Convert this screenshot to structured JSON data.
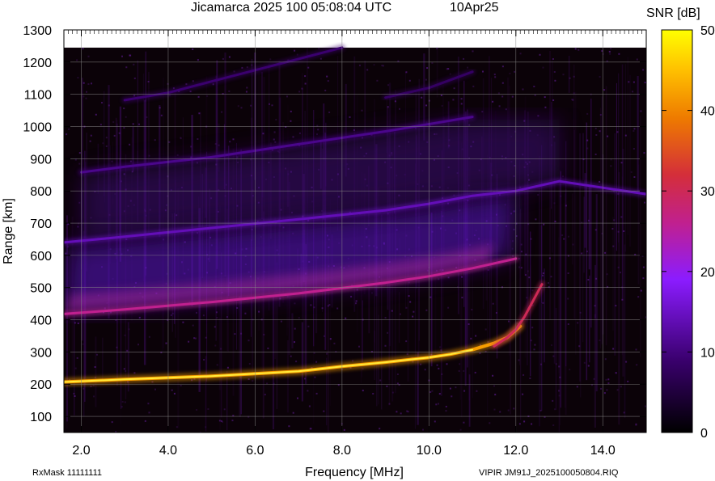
{
  "chart_data": {
    "type": "heatmap",
    "title": "Jicamarca 2025 100 05:08:04 UTC",
    "date_label": "10Apr25",
    "xlabel": "Frequency [MHz]",
    "ylabel": "Range [km]",
    "colorbar_label": "SNR [dB]",
    "xlim": [
      1.6,
      15.0
    ],
    "ylim": [
      50,
      1300
    ],
    "x_ticks": [
      "2.0",
      "4.0",
      "6.0",
      "8.0",
      "10.0",
      "12.0",
      "14.0"
    ],
    "x_tick_values": [
      2,
      4,
      6,
      8,
      10,
      12,
      14
    ],
    "y_ticks": [
      "100",
      "200",
      "300",
      "400",
      "500",
      "600",
      "700",
      "800",
      "900",
      "1000",
      "1100",
      "1200",
      "1300"
    ],
    "y_tick_values": [
      100,
      200,
      300,
      400,
      500,
      600,
      700,
      800,
      900,
      1000,
      1100,
      1200,
      1300
    ],
    "colorbar_ticks": [
      "0",
      "10",
      "20",
      "30",
      "40",
      "50"
    ],
    "colorbar_tick_values": [
      0,
      10,
      20,
      30,
      40,
      50
    ],
    "colorbar_range": [
      0,
      50
    ],
    "data_top_km": 1245,
    "echo_traces": [
      {
        "freq": [
          1.6,
          3,
          5,
          7,
          8,
          9,
          10,
          10.5,
          11,
          11.5,
          11.8,
          12.0,
          12.1
        ],
        "range": [
          207,
          215,
          225,
          240,
          255,
          268,
          283,
          293,
          307,
          327,
          345,
          368,
          380
        ],
        "snr": 42
      },
      {
        "freq": [
          11.5,
          11.8,
          12.0,
          12.2,
          12.4,
          12.6
        ],
        "range": [
          318,
          345,
          370,
          410,
          460,
          510
        ],
        "snr": 30
      },
      {
        "freq": [
          1.6,
          3,
          5,
          7,
          9,
          10,
          11,
          12
        ],
        "range": [
          418,
          432,
          455,
          482,
          515,
          535,
          560,
          590
        ],
        "snr": 26
      },
      {
        "freq": [
          1.6,
          3,
          5,
          7,
          9,
          10,
          11,
          12,
          13,
          14,
          15
        ],
        "range": [
          640,
          658,
          685,
          712,
          740,
          760,
          785,
          800,
          830,
          810,
          790
        ],
        "snr": 14
      },
      {
        "freq": [
          2,
          3,
          5,
          7,
          9,
          11
        ],
        "range": [
          858,
          875,
          905,
          945,
          985,
          1030
        ],
        "snr": 11
      },
      {
        "freq": [
          3,
          4,
          5,
          6,
          7,
          8
        ],
        "range": [
          1082,
          1105,
          1140,
          1175,
          1210,
          1245
        ],
        "snr": 9
      },
      {
        "freq": [
          9,
          10,
          11
        ],
        "range": [
          1090,
          1120,
          1170
        ],
        "snr": 8
      }
    ],
    "grid": true
  },
  "footer": {
    "rxmask": "RxMask 11111111",
    "filename": "VIPIR  JM91J_2025100050804.RIQ"
  }
}
